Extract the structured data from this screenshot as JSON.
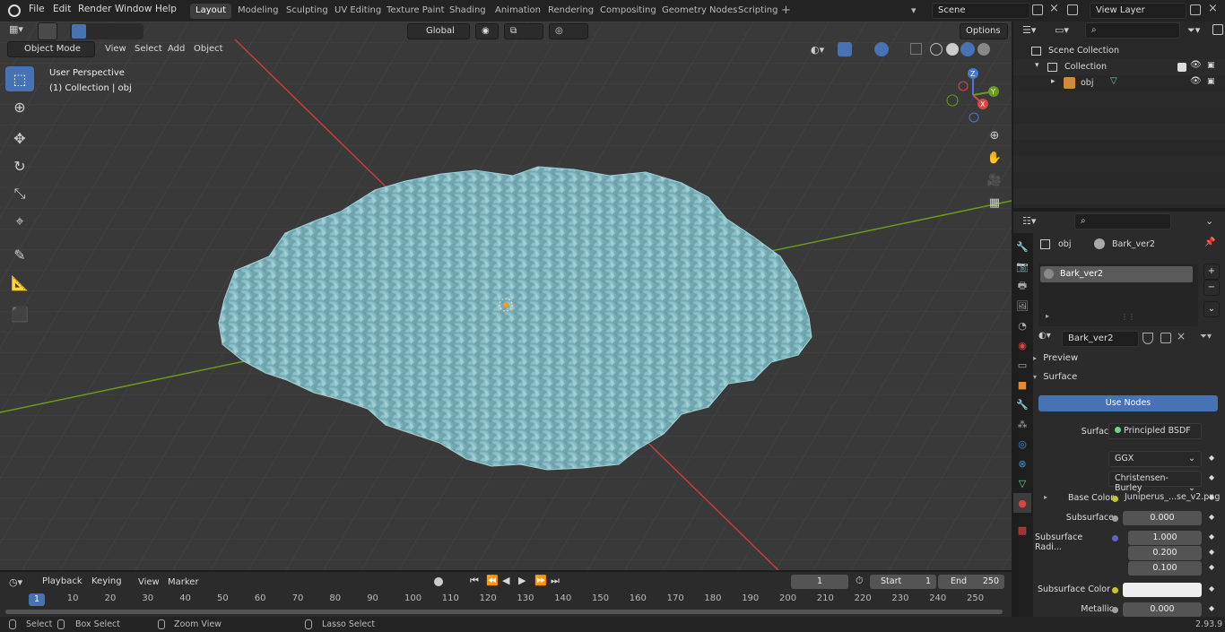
{
  "topbar": {
    "menus": [
      "File",
      "Edit",
      "Render",
      "Window",
      "Help"
    ],
    "workspaces": [
      "Layout",
      "Modeling",
      "Sculpting",
      "UV Editing",
      "Texture Paint",
      "Shading",
      "Animation",
      "Rendering",
      "Compositing",
      "Geometry Nodes",
      "Scripting"
    ],
    "active_workspace": "Layout",
    "scene": "Scene",
    "view_layer": "View Layer"
  },
  "viewport": {
    "mode": "Object Mode",
    "menus": [
      "View",
      "Select",
      "Add",
      "Object"
    ],
    "transform_orientation": "Global",
    "options_label": "Options",
    "perspective_label": "User Perspective",
    "collection_label": "(1) Collection | obj",
    "gizmo_axes": [
      "Z",
      "Y",
      "X"
    ]
  },
  "outliner": {
    "scene_collection": "Scene Collection",
    "collection": "Collection",
    "object": "obj"
  },
  "properties": {
    "breadcrumb_obj": "obj",
    "breadcrumb_mat": "Bark_ver2",
    "slot_material": "Bark_ver2",
    "material_name": "Bark_ver2",
    "panel_preview": "Preview",
    "panel_surface": "Surface",
    "use_nodes": "Use Nodes",
    "surface_label": "Surface",
    "surface_value": "Principled BSDF",
    "distribution": "GGX",
    "subsurface_method": "Christensen-Burley",
    "base_color_label": "Base Color",
    "base_color_value": "Juniperus_...se_v2.png",
    "subsurface_label": "Subsurface",
    "subsurface_value": "0.000",
    "subsurface_radius_label": "Subsurface Radi...",
    "subsurface_radius": [
      "1.000",
      "0.200",
      "0.100"
    ],
    "subsurface_color_label": "Subsurface Color",
    "metallic_label": "Metallic",
    "metallic_value": "0.000"
  },
  "timeline": {
    "menus": [
      "Playback",
      "Keying",
      "View",
      "Marker"
    ],
    "current_frame": "1",
    "start_label": "Start",
    "start_value": "1",
    "end_label": "End",
    "end_value": "250",
    "ruler": [
      "1",
      "10",
      "20",
      "30",
      "40",
      "50",
      "60",
      "70",
      "80",
      "90",
      "100",
      "110",
      "120",
      "130",
      "140",
      "150",
      "160",
      "170",
      "180",
      "190",
      "200",
      "210",
      "220",
      "230",
      "240",
      "250"
    ]
  },
  "statusbar": {
    "select": "Select",
    "box_select": "Box Select",
    "zoom_view": "Zoom View",
    "lasso_select": "Lasso Select",
    "version": "2.93.9"
  },
  "colors": {
    "accent": "#4772b3",
    "x_axis": "#c73c3c",
    "y_axis": "#6a9a1f",
    "foliage": "#8ec4cc"
  }
}
